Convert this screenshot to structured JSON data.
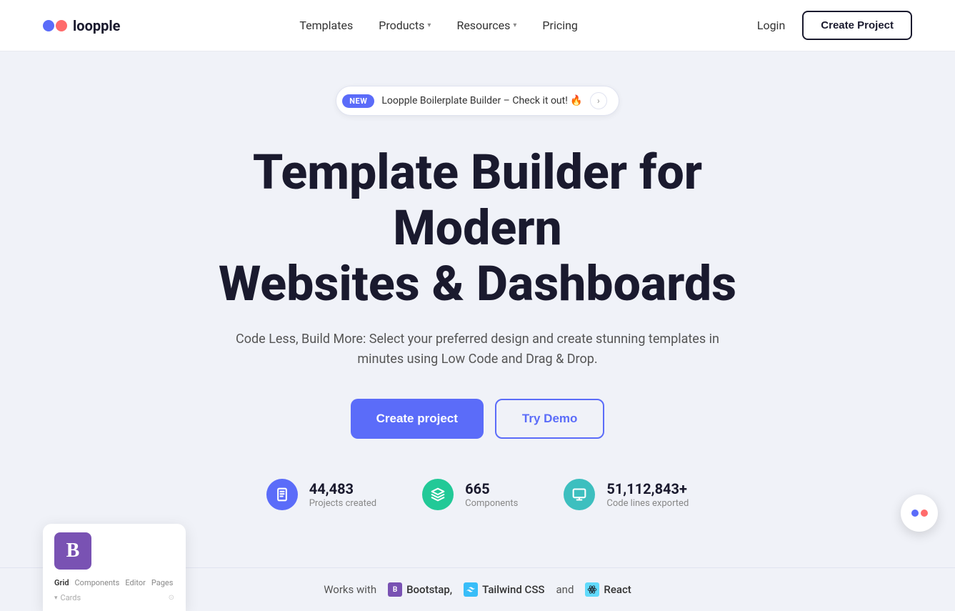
{
  "brand": {
    "name": "loopple"
  },
  "navbar": {
    "templates_label": "Templates",
    "products_label": "Products",
    "resources_label": "Resources",
    "pricing_label": "Pricing",
    "login_label": "Login",
    "create_project_label": "Create Project"
  },
  "announcement": {
    "badge": "NEW",
    "text": "Loopple Boilerplate Builder – Check it out! 🔥"
  },
  "hero": {
    "heading_line1": "Template Builder for Modern",
    "heading_line2": "Websites & Dashboards",
    "subtext": "Code Less, Build More: Select your preferred design and create stunning templates in minutes using Low Code and Drag & Drop.",
    "create_project_label": "Create project",
    "try_demo_label": "Try Demo"
  },
  "stats": [
    {
      "number": "44,483",
      "label": "Projects created",
      "icon": "copy-icon",
      "color": "blue"
    },
    {
      "number": "665",
      "label": "Components",
      "icon": "puzzle-icon",
      "color": "green"
    },
    {
      "number": "51,112,843+",
      "label": "Code lines exported",
      "icon": "monitor-icon",
      "color": "teal"
    }
  ],
  "works_with": {
    "prefix": "Works with",
    "technologies": [
      {
        "name": "Bootstap",
        "icon": "B"
      },
      {
        "name": "Tailwind CSS",
        "icon": "~"
      },
      {
        "name": "React",
        "icon": "⚛"
      }
    ],
    "separator": "and"
  },
  "preview": {
    "tabs": [
      "Grid",
      "Components",
      "Editor",
      "Pages"
    ],
    "item": "Cards"
  },
  "chat": {
    "label": "Chat support"
  }
}
